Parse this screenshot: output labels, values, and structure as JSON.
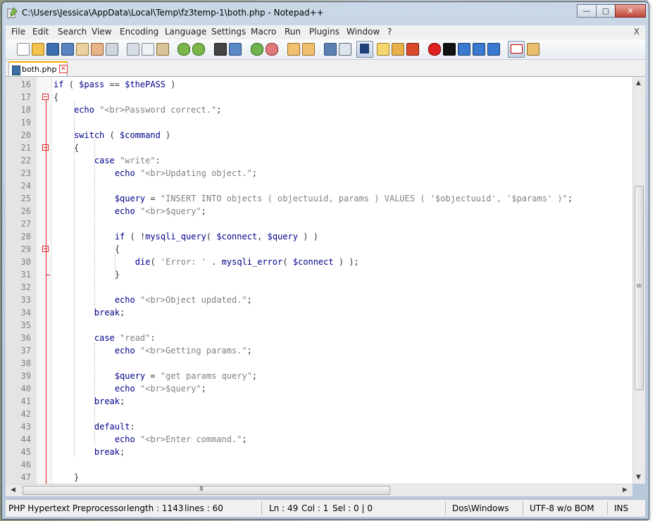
{
  "window": {
    "title": "C:\\Users\\Jessica\\AppData\\Local\\Temp\\fz3temp-1\\both.php - Notepad++"
  },
  "caption_buttons": {
    "minimize": "—",
    "maximize": "▢",
    "close": "✕"
  },
  "menu": [
    "File",
    "Edit",
    "Search",
    "View",
    "Encoding",
    "Language",
    "Settings",
    "Macro",
    "Run",
    "Plugins",
    "Window",
    "?"
  ],
  "menu_close": "X",
  "tab": {
    "label": "both.php",
    "close": "✕"
  },
  "code_lines": [
    {
      "num": "16",
      "text": "if ( $pass == $thePASS )"
    },
    {
      "num": "17",
      "text": "{"
    },
    {
      "num": "18",
      "text": "    echo \"<br>Password correct.\";"
    },
    {
      "num": "19",
      "text": ""
    },
    {
      "num": "20",
      "text": "    switch ( $command )"
    },
    {
      "num": "21",
      "text": "    {"
    },
    {
      "num": "22",
      "text": "        case \"write\":"
    },
    {
      "num": "23",
      "text": "            echo \"<br>Updating object.\";"
    },
    {
      "num": "24",
      "text": ""
    },
    {
      "num": "25",
      "text": "            $query = \"INSERT INTO objects ( objectuuid, params ) VALUES ( '$objectuuid', '$params' )\";"
    },
    {
      "num": "26",
      "text": "            echo \"<br>$query\";"
    },
    {
      "num": "27",
      "text": ""
    },
    {
      "num": "28",
      "text": "            if ( !mysqli_query( $connect, $query ) )"
    },
    {
      "num": "29",
      "text": "            {"
    },
    {
      "num": "30",
      "text": "                die( 'Error: ' . mysqli_error( $connect ) );"
    },
    {
      "num": "31",
      "text": "            }"
    },
    {
      "num": "32",
      "text": ""
    },
    {
      "num": "33",
      "text": "            echo \"<br>Object updated.\";"
    },
    {
      "num": "34",
      "text": "        break;"
    },
    {
      "num": "35",
      "text": ""
    },
    {
      "num": "36",
      "text": "        case \"read\":"
    },
    {
      "num": "37",
      "text": "            echo \"<br>Getting params.\";"
    },
    {
      "num": "38",
      "text": ""
    },
    {
      "num": "39",
      "text": "            $query = \"get params query\";"
    },
    {
      "num": "40",
      "text": "            echo \"<br>$query\";"
    },
    {
      "num": "41",
      "text": "        break;"
    },
    {
      "num": "42",
      "text": ""
    },
    {
      "num": "43",
      "text": "        default:"
    },
    {
      "num": "44",
      "text": "            echo \"<br>Enter command.\";"
    },
    {
      "num": "45",
      "text": "        break;"
    },
    {
      "num": "46",
      "text": ""
    },
    {
      "num": "47",
      "text": "    }"
    }
  ],
  "statusbar": {
    "filetype": "PHP Hypertext Preprocessor file",
    "length": "length : 1143",
    "lines": "lines : 60",
    "ln": "Ln : 49",
    "col": "Col : 1",
    "sel": "Sel : 0 | 0",
    "eol": "Dos\\Windows",
    "encoding": "UTF-8 w/o BOM",
    "mode": "INS"
  },
  "scrollbar": {
    "h_grip": "III",
    "v_grip": "≡"
  },
  "colors": {
    "keyword": "#00008b",
    "string": "#808080",
    "fold_marker": "#dd2222",
    "active_tab": "#f4b400"
  }
}
